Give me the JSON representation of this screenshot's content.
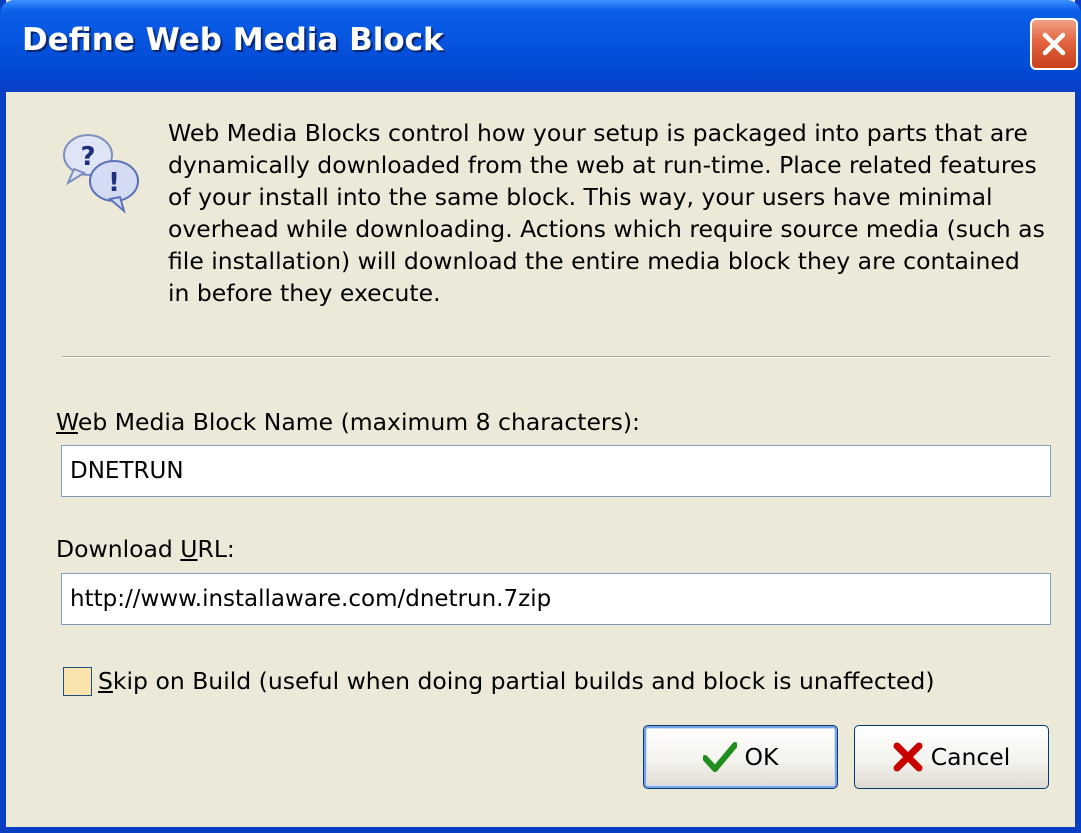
{
  "window": {
    "title": "Define Web Media Block"
  },
  "description": "Web Media Blocks control how your setup is packaged into parts that are dynamically downloaded from the web at run-time. Place related features of your install into the same block. This way, your users have minimal overhead while downloading. Actions which require source media (such as file installation) will download the entire media block they are contained in before they execute.",
  "icons": {
    "info": "question-exclamation-bubbles-icon",
    "close": "close-icon",
    "ok": "checkmark-icon",
    "cancel": "red-x-icon"
  },
  "block_name": {
    "label_accel": "W",
    "label_rest": "eb Media Block Name (maximum 8 characters):",
    "value": "DNETRUN"
  },
  "download_url": {
    "label_pre": "Download ",
    "label_accel": "U",
    "label_rest": "RL:",
    "value": "http://www.installaware.com/dnetrun.7zip"
  },
  "skip_on_build": {
    "label_accel": "S",
    "label_rest": "kip on Build (useful when doing partial builds and block is unaffected)",
    "checked": false
  },
  "buttons": {
    "ok": "OK",
    "cancel": "Cancel"
  },
  "colors": {
    "titlebar": "#0654df",
    "dialog_bg": "#ece9d8",
    "close": "#e2643e"
  }
}
